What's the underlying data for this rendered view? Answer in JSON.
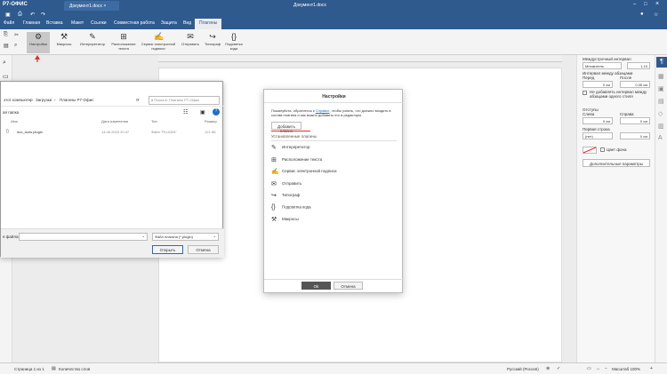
{
  "titlebar": {
    "app": "Р7-ОФИС",
    "tab": "Документ1.docx",
    "document": "Документ1.docx"
  },
  "menu": [
    "Файл",
    "Главная",
    "Вставка",
    "Макет",
    "Ссылки",
    "Совместная работа",
    "Защита",
    "Вид",
    "Плагины"
  ],
  "ribbon": {
    "settings": "Настройки",
    "macros": "Макросы",
    "interpreter": "Интерпретатор",
    "text_layout": "Расположение текста",
    "esign": "Сервис электронной подписи",
    "send": "Отправить",
    "typograph": "Типограф",
    "code_highlight": "Подсветка кода"
  },
  "filedialog": {
    "path": [
      "этот компьютер",
      "Загрузки",
      "Плагины Р7-Офис"
    ],
    "search_placeholder": "Поиск в: Плагины Р7-Офис",
    "new_folder": "ая папка",
    "columns": {
      "name": "Имя",
      "date": "Дата изменения",
      "type": "Тип",
      "size": "Размер"
    },
    "file": {
      "name": "doc_tools.plugin",
      "date": "14.06.2023 20:47",
      "type": "Файл \"PLUGIN\"",
      "size": "121 КБ"
    },
    "filename_label": "я файла:",
    "filter": "Файл плагина (*.plugin)",
    "open": "Открыть",
    "cancel": "Отмена"
  },
  "settings": {
    "title": "Настройки",
    "hint_pre": "Пожалуйста, обратитесь к",
    "hint_link": "Справке",
    "hint_post": ", чтобы узнать, что должно входить в состав плагина и как можно добавить его в редакторы.",
    "add": "Добавить плагин",
    "installed": "Установленные плагины",
    "plugins": [
      {
        "icon": "interpreter-icon",
        "glyph": "✎",
        "label": "Интерпретатор"
      },
      {
        "icon": "text-layout-icon",
        "glyph": "⊞",
        "label": "Расположение текста"
      },
      {
        "icon": "esign-icon",
        "glyph": "✍",
        "label": "Сервис электронной подписи"
      },
      {
        "icon": "send-icon",
        "glyph": "✉",
        "label": "Отправить"
      },
      {
        "icon": "typograph-icon",
        "glyph": "↪",
        "label": "Типограф"
      },
      {
        "icon": "code-icon",
        "glyph": "{}",
        "label": "Подсветка кода"
      },
      {
        "icon": "macros-icon",
        "glyph": "⚒",
        "label": "Макросы"
      }
    ],
    "ok": "Ok",
    "cancel": "Отмена"
  },
  "rightpanel": {
    "line_spacing": "Междустрочный интервал",
    "multiplier": "Множитель",
    "ls_value": "1,15",
    "para_spacing": "Интервал между абзацами",
    "before": "Перед",
    "after": "После",
    "before_val": "0 см",
    "after_val": "0,35 см",
    "no_interval": "Не добавлять интервал между абзацами одного стиля",
    "indents": "Отступы",
    "left": "Слева",
    "right": "Справа",
    "left_val": "0 см",
    "right_val": "0 см",
    "first_line": "Первая строка",
    "first_line_type": "(нет)",
    "first_line_val": "0 см",
    "bg_color": "Цвет фона",
    "advanced": "Дополнительные параметры"
  },
  "status": {
    "page": "Страница 1 из 1",
    "words": "Количество слов",
    "lang": "Русский (Россия)",
    "zoom": "Масштаб 100%"
  }
}
